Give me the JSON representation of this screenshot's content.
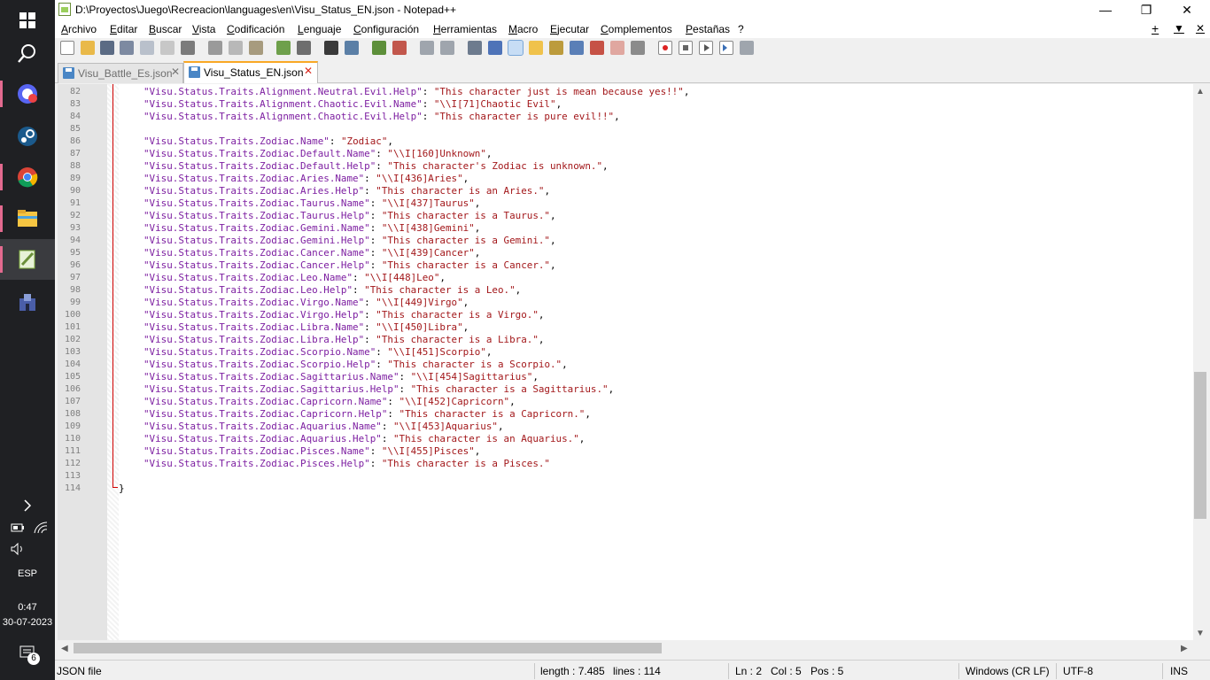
{
  "window": {
    "title": "D:\\Proyectos\\Juego\\Recreacion\\languages\\en\\Visu_Status_EN.json - Notepad++",
    "minimize": "—",
    "restore": "❐",
    "close": "✕"
  },
  "menu": {
    "items": [
      "Archivo",
      "Editar",
      "Buscar",
      "Vista",
      "Codificación",
      "Lenguaje",
      "Configuración",
      "Herramientas",
      "Macro",
      "Ejecutar",
      "Complementos",
      "Pestañas",
      "?"
    ],
    "extra_plus": "+",
    "extra_down": "▼",
    "extra_close": "✕"
  },
  "tabs": [
    {
      "label": "Visu_Battle_Es.json",
      "active": false,
      "close": "✕"
    },
    {
      "label": "Visu_Status_EN.json",
      "active": true,
      "close": "✕"
    }
  ],
  "editor": {
    "lines": [
      {
        "n": "82",
        "k": "\"Visu.Status.Traits.Alignment.Neutral.Evil.Help\"",
        "v": "\"This character just is mean because yes!!\"",
        "e": ","
      },
      {
        "n": "83",
        "k": "\"Visu.Status.Traits.Alignment.Chaotic.Evil.Name\"",
        "v": "\"\\\\I[71]Chaotic Evil\"",
        "e": ","
      },
      {
        "n": "84",
        "k": "\"Visu.Status.Traits.Alignment.Chaotic.Evil.Help\"",
        "v": "\"This character is pure evil!!\"",
        "e": ","
      },
      {
        "n": "85",
        "k": "",
        "v": "",
        "e": ""
      },
      {
        "n": "86",
        "k": "\"Visu.Status.Traits.Zodiac.Name\"",
        "v": "\"Zodiac\"",
        "e": ","
      },
      {
        "n": "87",
        "k": "\"Visu.Status.Traits.Zodiac.Default.Name\"",
        "v": "\"\\\\I[160]Unknown\"",
        "e": ","
      },
      {
        "n": "88",
        "k": "\"Visu.Status.Traits.Zodiac.Default.Help\"",
        "v": "\"This character's Zodiac is unknown.\"",
        "e": ","
      },
      {
        "n": "89",
        "k": "\"Visu.Status.Traits.Zodiac.Aries.Name\"",
        "v": "\"\\\\I[436]Aries\"",
        "e": ","
      },
      {
        "n": "90",
        "k": "\"Visu.Status.Traits.Zodiac.Aries.Help\"",
        "v": "\"This character is an Aries.\"",
        "e": ","
      },
      {
        "n": "91",
        "k": "\"Visu.Status.Traits.Zodiac.Taurus.Name\"",
        "v": "\"\\\\I[437]Taurus\"",
        "e": ","
      },
      {
        "n": "92",
        "k": "\"Visu.Status.Traits.Zodiac.Taurus.Help\"",
        "v": "\"This character is a Taurus.\"",
        "e": ","
      },
      {
        "n": "93",
        "k": "\"Visu.Status.Traits.Zodiac.Gemini.Name\"",
        "v": "\"\\\\I[438]Gemini\"",
        "e": ","
      },
      {
        "n": "94",
        "k": "\"Visu.Status.Traits.Zodiac.Gemini.Help\"",
        "v": "\"This character is a Gemini.\"",
        "e": ","
      },
      {
        "n": "95",
        "k": "\"Visu.Status.Traits.Zodiac.Cancer.Name\"",
        "v": "\"\\\\I[439]Cancer\"",
        "e": ","
      },
      {
        "n": "96",
        "k": "\"Visu.Status.Traits.Zodiac.Cancer.Help\"",
        "v": "\"This character is a Cancer.\"",
        "e": ","
      },
      {
        "n": "97",
        "k": "\"Visu.Status.Traits.Zodiac.Leo.Name\"",
        "v": "\"\\\\I[448]Leo\"",
        "e": ","
      },
      {
        "n": "98",
        "k": "\"Visu.Status.Traits.Zodiac.Leo.Help\"",
        "v": "\"This character is a Leo.\"",
        "e": ","
      },
      {
        "n": "99",
        "k": "\"Visu.Status.Traits.Zodiac.Virgo.Name\"",
        "v": "\"\\\\I[449]Virgo\"",
        "e": ","
      },
      {
        "n": "100",
        "k": "\"Visu.Status.Traits.Zodiac.Virgo.Help\"",
        "v": "\"This character is a Virgo.\"",
        "e": ","
      },
      {
        "n": "101",
        "k": "\"Visu.Status.Traits.Zodiac.Libra.Name\"",
        "v": "\"\\\\I[450]Libra\"",
        "e": ","
      },
      {
        "n": "102",
        "k": "\"Visu.Status.Traits.Zodiac.Libra.Help\"",
        "v": "\"This character is a Libra.\"",
        "e": ","
      },
      {
        "n": "103",
        "k": "\"Visu.Status.Traits.Zodiac.Scorpio.Name\"",
        "v": "\"\\\\I[451]Scorpio\"",
        "e": ","
      },
      {
        "n": "104",
        "k": "\"Visu.Status.Traits.Zodiac.Scorpio.Help\"",
        "v": "\"This character is a Scorpio.\"",
        "e": ","
      },
      {
        "n": "105",
        "k": "\"Visu.Status.Traits.Zodiac.Sagittarius.Name\"",
        "v": "\"\\\\I[454]Sagittarius\"",
        "e": ","
      },
      {
        "n": "106",
        "k": "\"Visu.Status.Traits.Zodiac.Sagittarius.Help\"",
        "v": "\"This character is a Sagittarius.\"",
        "e": ","
      },
      {
        "n": "107",
        "k": "\"Visu.Status.Traits.Zodiac.Capricorn.Name\"",
        "v": "\"\\\\I[452]Capricorn\"",
        "e": ","
      },
      {
        "n": "108",
        "k": "\"Visu.Status.Traits.Zodiac.Capricorn.Help\"",
        "v": "\"This character is a Capricorn.\"",
        "e": ","
      },
      {
        "n": "109",
        "k": "\"Visu.Status.Traits.Zodiac.Aquarius.Name\"",
        "v": "\"\\\\I[453]Aquarius\"",
        "e": ","
      },
      {
        "n": "110",
        "k": "\"Visu.Status.Traits.Zodiac.Aquarius.Help\"",
        "v": "\"This character is an Aquarius.\"",
        "e": ","
      },
      {
        "n": "111",
        "k": "\"Visu.Status.Traits.Zodiac.Pisces.Name\"",
        "v": "\"\\\\I[455]Pisces\"",
        "e": ","
      },
      {
        "n": "112",
        "k": "\"Visu.Status.Traits.Zodiac.Pisces.Help\"",
        "v": "\"This character is a Pisces.\"",
        "e": ""
      },
      {
        "n": "113",
        "k": "",
        "v": "",
        "e": ""
      },
      {
        "n": "114",
        "k": "",
        "v": "",
        "e": "}",
        "closing": true
      }
    ],
    "colors": {
      "key": "#7d1fa1",
      "string": "#a3181b",
      "fold": "#d00000"
    }
  },
  "statusbar": {
    "filetype": "JSON file",
    "length": "length : 7.485",
    "lines": "lines : 114",
    "ln": "Ln : 2",
    "col": "Col : 5",
    "pos": "Pos : 5",
    "eol": "Windows (CR LF)",
    "encoding": "UTF-8",
    "mode": "INS"
  },
  "taskbar": {
    "language": "ESP",
    "time": "0:47",
    "date": "30-07-2023",
    "notifications": "6"
  }
}
